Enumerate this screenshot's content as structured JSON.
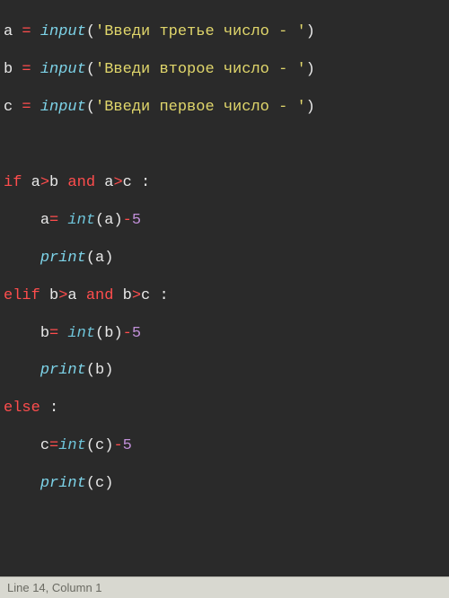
{
  "code": {
    "l1": {
      "v": "a",
      "op": "=",
      "fn": "input",
      "lp": "(",
      "s": "'Введи третье число - '",
      "rp": ")"
    },
    "l2": {
      "v": "b",
      "op": "=",
      "fn": "input",
      "lp": "(",
      "s": "'Введи второе число - '",
      "rp": ")"
    },
    "l3": {
      "v": "c",
      "op": "=",
      "fn": "input",
      "lp": "(",
      "s": "'Введи первое число - '",
      "rp": ")"
    },
    "l5": {
      "kw1": "if",
      "v1": "a",
      "op1": ">",
      "v2": "b",
      "kw2": "and",
      "v3": "a",
      "op2": ">",
      "v4": "c",
      "colon": " :"
    },
    "l6": {
      "indent": "    ",
      "v": "a",
      "eq": "=",
      "sp": " ",
      "fn": "int",
      "lp": "(",
      "arg": "a",
      "rp": ")",
      "minus": "-",
      "num": "5"
    },
    "l7": {
      "indent": "    ",
      "fn": "print",
      "lp": "(",
      "arg": "a",
      "rp": ")"
    },
    "l8": {
      "kw1": "elif",
      "v1": "b",
      "op1": ">",
      "v2": "a",
      "kw2": "and",
      "v3": "b",
      "op2": ">",
      "v4": "c",
      "colon": " :"
    },
    "l9": {
      "indent": "    ",
      "v": "b",
      "eq": "=",
      "sp": " ",
      "fn": "int",
      "lp": "(",
      "arg": "b",
      "rp": ")",
      "minus": "-",
      "num": "5"
    },
    "l10": {
      "indent": "    ",
      "fn": "print",
      "lp": "(",
      "arg": "b",
      "rp": ")"
    },
    "l11": {
      "kw": "else",
      "colon": " :"
    },
    "l12": {
      "indent": "    ",
      "v": "c",
      "eq": "=",
      "fn": "int",
      "lp": "(",
      "arg": "c",
      "rp": ")",
      "minus": "-",
      "num": "5"
    },
    "l13": {
      "indent": "    ",
      "fn": "print",
      "lp": "(",
      "arg": "c",
      "rp": ")"
    }
  },
  "statusbar": {
    "cursor": "Line 14, Column 1"
  }
}
